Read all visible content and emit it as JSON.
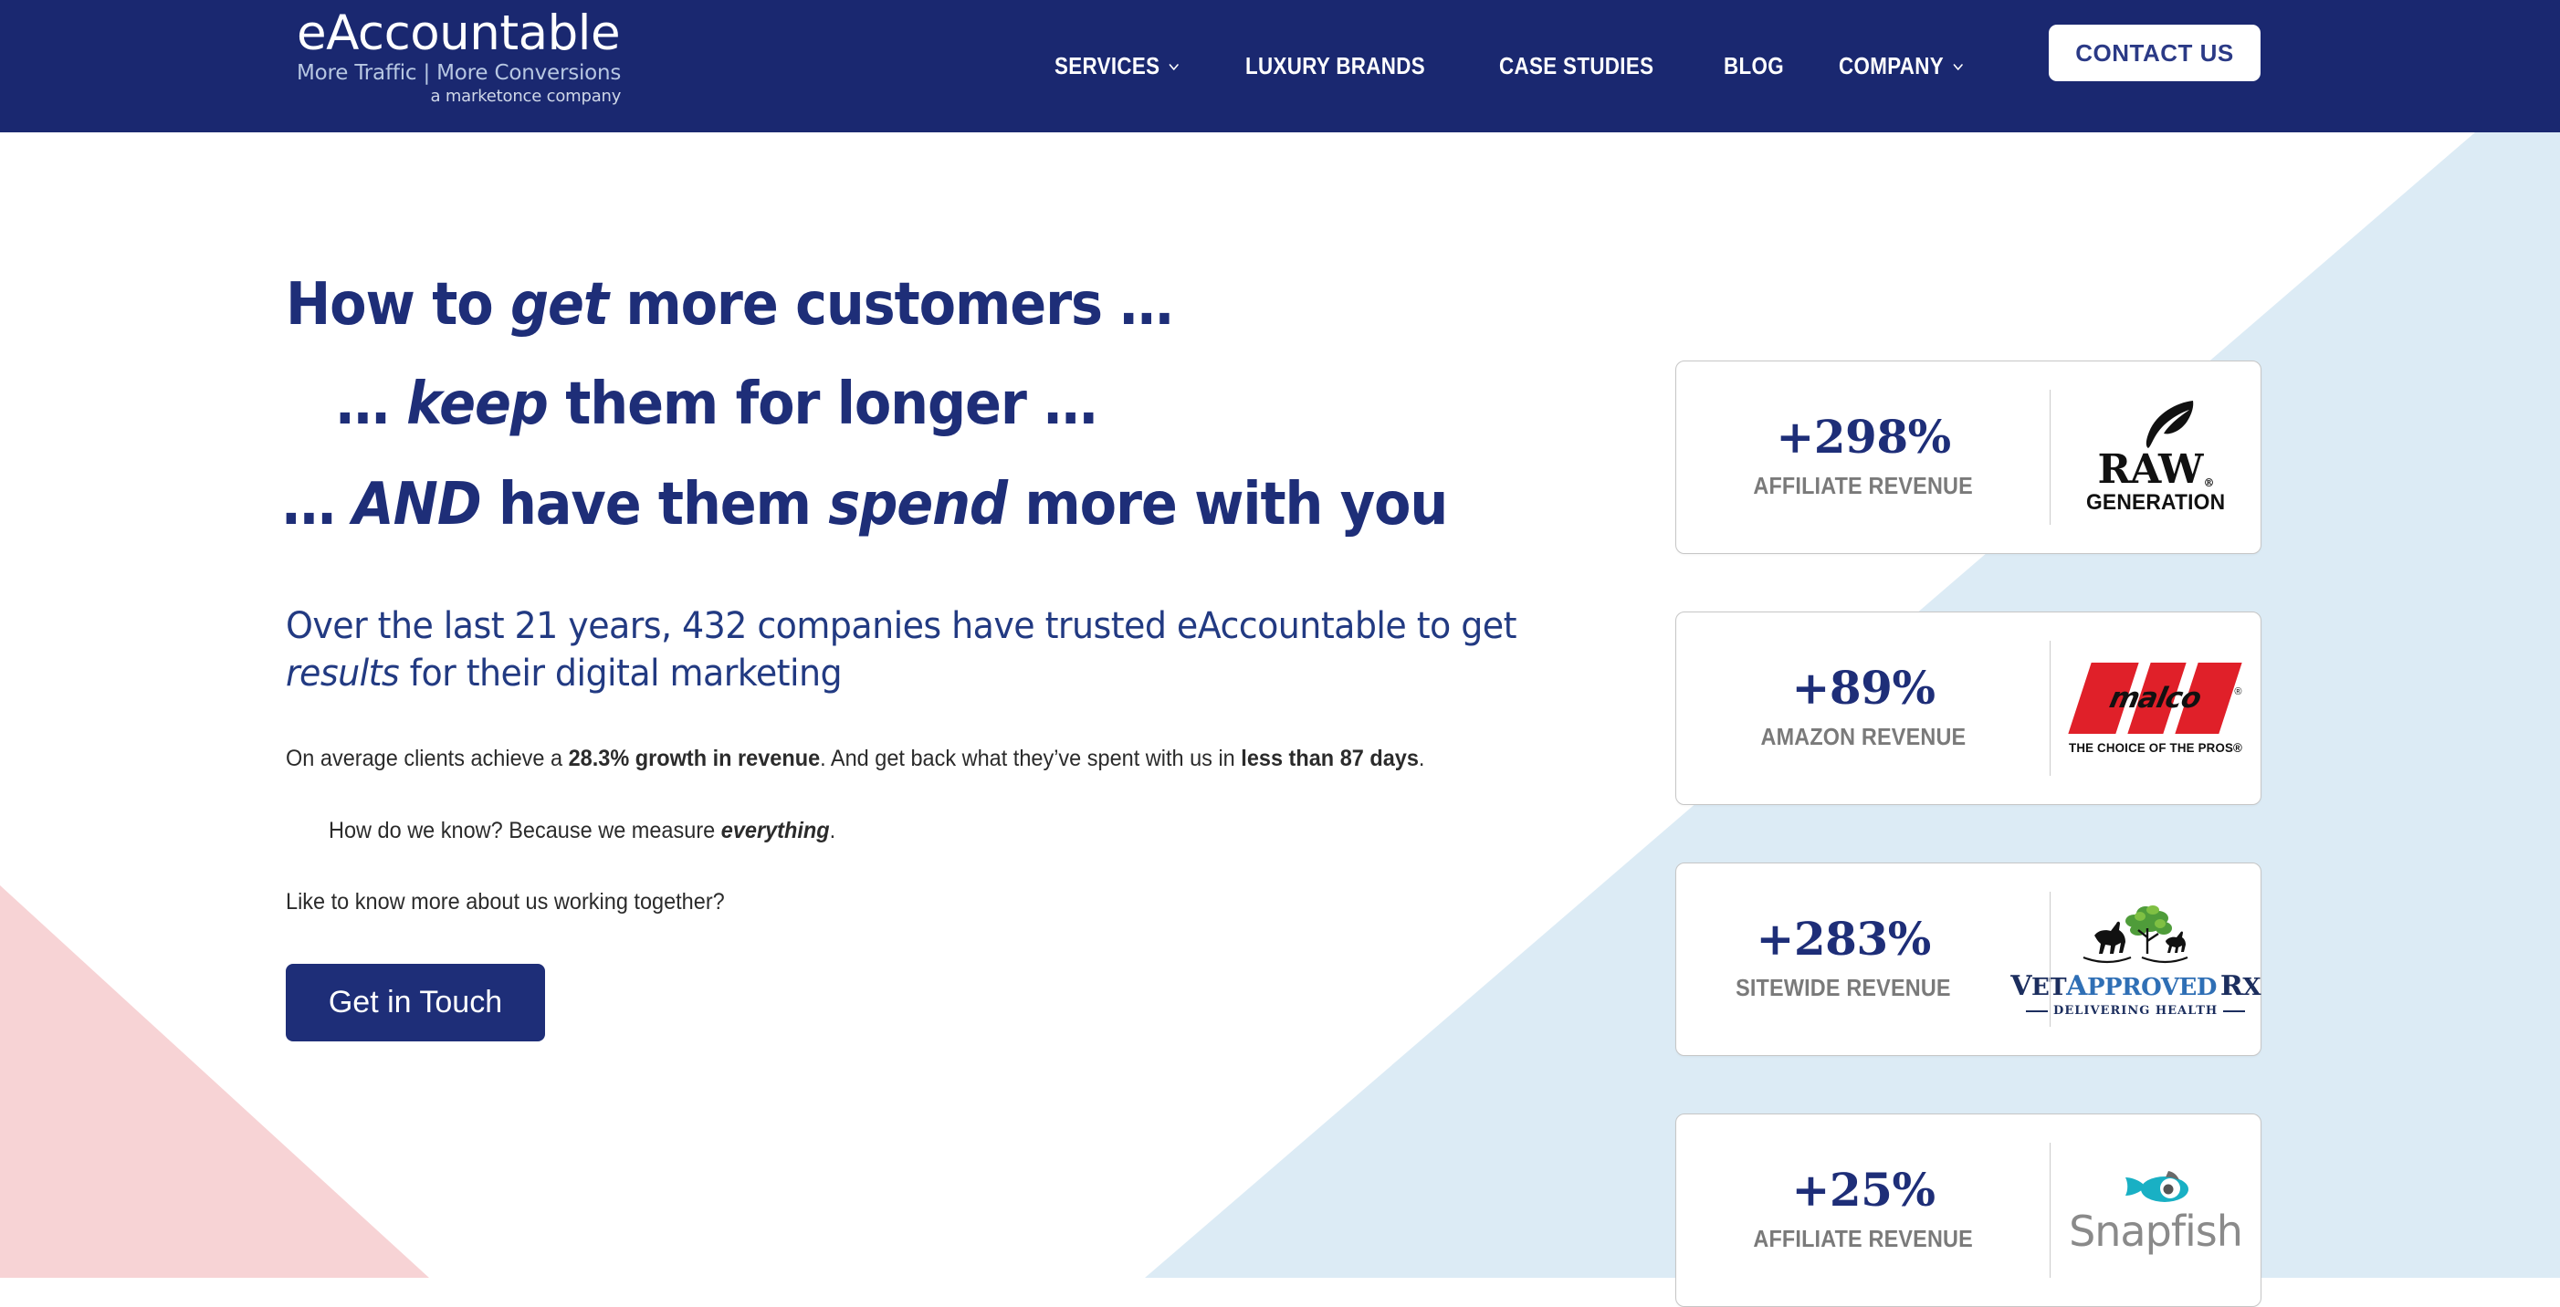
{
  "header": {
    "logo": {
      "name": "eAccountable",
      "tagline": "More Traffic | More Conversions",
      "parent": "a marketonce company"
    },
    "nav": [
      {
        "label": "SERVICES",
        "has_dropdown": true
      },
      {
        "label": "LUXURY BRANDS",
        "has_dropdown": false
      },
      {
        "label": "CASE STUDIES",
        "has_dropdown": false
      },
      {
        "label": "BLOG",
        "has_dropdown": false
      },
      {
        "label": "COMPANY",
        "has_dropdown": true
      }
    ],
    "contact_button": "CONTACT US",
    "background_color": "#1a2870"
  },
  "hero": {
    "headline": {
      "line1_a": "How to ",
      "line1_i": "get",
      "line1_b": " more customers …",
      "line2_a": "… ",
      "line2_i": "keep",
      "line2_b": " them for longer …",
      "line3_a": "… ",
      "line3_i": "AND",
      "line3_b": " have them ",
      "line3_i2": "spend",
      "line3_c": " more with you"
    },
    "subheading": {
      "part1": "Over the last 21 years, 432 companies have trusted eAccountable to get ",
      "italic": "results",
      "part2": " for their digital marketing"
    },
    "paragraphs": {
      "p1_a": "On average clients achieve a ",
      "p1_b1": "28.3% growth in revenue",
      "p1_b": ". And get back what they’ve spent with us in ",
      "p1_b2": "less than 87 days",
      "p1_c": ".",
      "p2_a": "How do we know? Because we measure ",
      "p2_b": "everything",
      "p2_c": ".",
      "p3": "Like to know more about us working together?"
    },
    "cta_button": "Get in Touch"
  },
  "stat_cards": [
    {
      "percent": "+298%",
      "label": "AFFILIATE REVENUE",
      "brand": "Raw Generation",
      "logo_text_top": "RAW",
      "logo_text_bottom": "GENERATION",
      "logo_registered": "®"
    },
    {
      "percent": "+89%",
      "label": "AMAZON REVENUE",
      "brand": "Malco",
      "logo_text_top": "malco",
      "logo_text_bottom": "THE CHOICE OF THE PROS®",
      "logo_registered": "®"
    },
    {
      "percent": "+283%",
      "label": "SITEWIDE REVENUE",
      "brand": "VetApprovedRx",
      "logo_text_top_a": "V",
      "logo_text_top_b": "ET",
      "logo_text_top_c": "A",
      "logo_text_top_d": "PPROVED",
      "logo_text_top_e": "R",
      "logo_text_top_f": "X",
      "logo_text_bottom": "DELIVERING HEALTH"
    },
    {
      "percent": "+25%",
      "label": "AFFILIATE REVENUE",
      "brand": "Snapfish",
      "logo_text_top": "Snapfish",
      "logo_text_bottom": ""
    }
  ],
  "colors": {
    "navy": "#1e2e78",
    "header_navy": "#1a2870",
    "gray_label": "#7a7a7a",
    "wedge_blue": "#dcebf5",
    "wedge_pink": "#f7d3d5",
    "malco_red": "#e02029",
    "snapfish_teal": "#19b0c4"
  }
}
